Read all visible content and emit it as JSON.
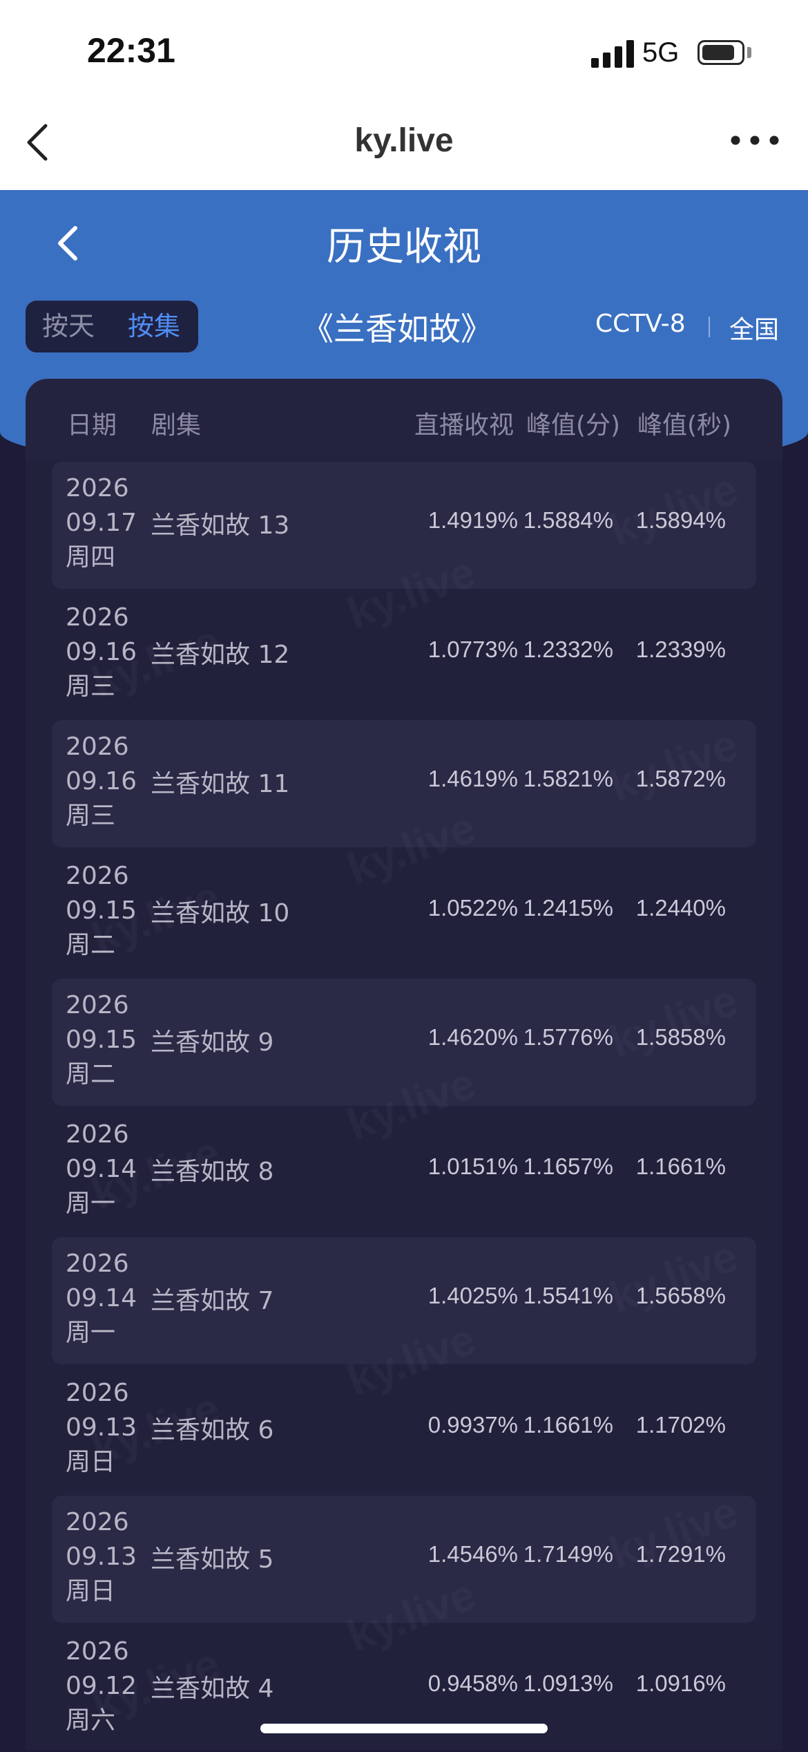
{
  "status_bar": {
    "time": "22:31",
    "network": "5G"
  },
  "browser": {
    "title": "ky.live"
  },
  "header": {
    "title": "历史收视",
    "toggle": [
      "按天",
      "按集"
    ],
    "show_title": "《兰香如故》",
    "channel": "CCTV-8",
    "region": "全国"
  },
  "table": {
    "columns": [
      "日期",
      "剧集",
      "直播收视",
      "峰值(分)",
      "峰值(秒)"
    ],
    "rows": [
      {
        "year": "2026",
        "date": "09.17",
        "weekday": "周四",
        "episode": "兰香如故 13",
        "live": "1.4919%",
        "peak_min": "1.5884%",
        "peak_sec": "1.5894%"
      },
      {
        "year": "2026",
        "date": "09.16",
        "weekday": "周三",
        "episode": "兰香如故 12",
        "live": "1.0773%",
        "peak_min": "1.2332%",
        "peak_sec": "1.2339%"
      },
      {
        "year": "2026",
        "date": "09.16",
        "weekday": "周三",
        "episode": "兰香如故 11",
        "live": "1.4619%",
        "peak_min": "1.5821%",
        "peak_sec": "1.5872%"
      },
      {
        "year": "2026",
        "date": "09.15",
        "weekday": "周二",
        "episode": "兰香如故 10",
        "live": "1.0522%",
        "peak_min": "1.2415%",
        "peak_sec": "1.2440%"
      },
      {
        "year": "2026",
        "date": "09.15",
        "weekday": "周二",
        "episode": "兰香如故 9",
        "live": "1.4620%",
        "peak_min": "1.5776%",
        "peak_sec": "1.5858%"
      },
      {
        "year": "2026",
        "date": "09.14",
        "weekday": "周一",
        "episode": "兰香如故 8",
        "live": "1.0151%",
        "peak_min": "1.1657%",
        "peak_sec": "1.1661%"
      },
      {
        "year": "2026",
        "date": "09.14",
        "weekday": "周一",
        "episode": "兰香如故 7",
        "live": "1.4025%",
        "peak_min": "1.5541%",
        "peak_sec": "1.5658%"
      },
      {
        "year": "2026",
        "date": "09.13",
        "weekday": "周日",
        "episode": "兰香如故 6",
        "live": "0.9937%",
        "peak_min": "1.1661%",
        "peak_sec": "1.1702%"
      },
      {
        "year": "2026",
        "date": "09.13",
        "weekday": "周日",
        "episode": "兰香如故 5",
        "live": "1.4546%",
        "peak_min": "1.7149%",
        "peak_sec": "1.7291%"
      },
      {
        "year": "2026",
        "date": "09.12",
        "weekday": "周六",
        "episode": "兰香如故 4",
        "live": "0.9458%",
        "peak_min": "1.0913%",
        "peak_sec": "1.0916%"
      }
    ]
  },
  "watermark": "ky.live"
}
